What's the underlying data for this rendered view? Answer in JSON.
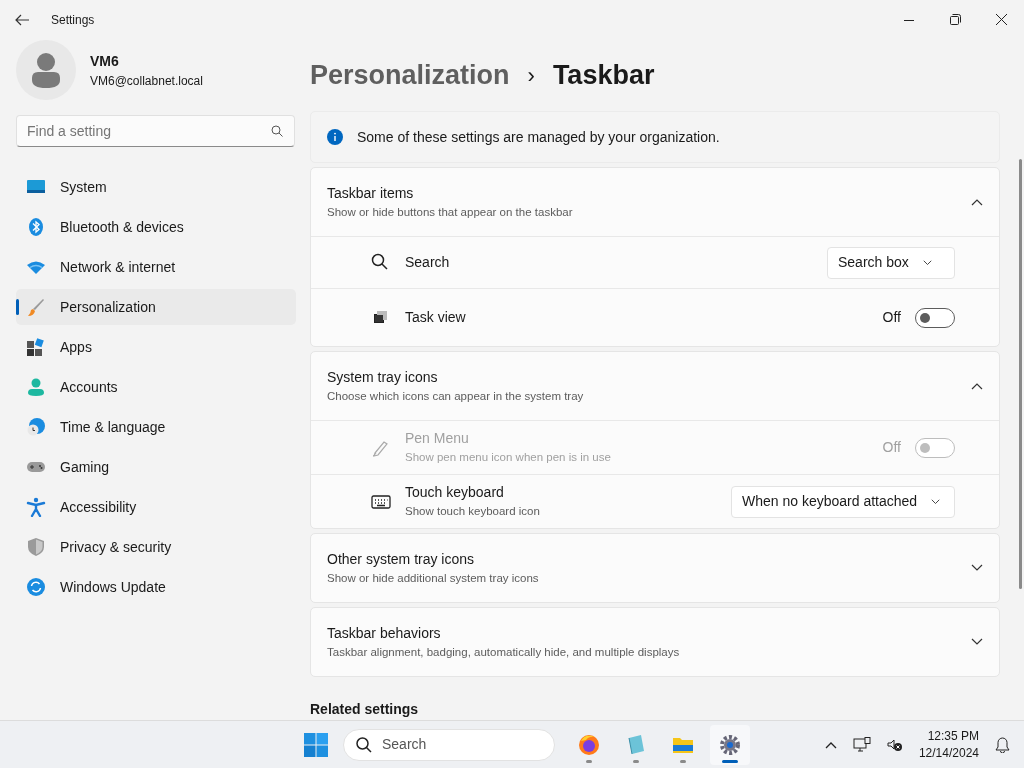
{
  "window": {
    "title": "Settings"
  },
  "user": {
    "name": "VM6",
    "email": "VM6@collabnet.local"
  },
  "search": {
    "placeholder": "Find a setting"
  },
  "nav": [
    {
      "label": "System",
      "selected": false
    },
    {
      "label": "Bluetooth & devices",
      "selected": false
    },
    {
      "label": "Network & internet",
      "selected": false
    },
    {
      "label": "Personalization",
      "selected": true
    },
    {
      "label": "Apps",
      "selected": false
    },
    {
      "label": "Accounts",
      "selected": false
    },
    {
      "label": "Time & language",
      "selected": false
    },
    {
      "label": "Gaming",
      "selected": false
    },
    {
      "label": "Accessibility",
      "selected": false
    },
    {
      "label": "Privacy & security",
      "selected": false
    },
    {
      "label": "Windows Update",
      "selected": false
    }
  ],
  "breadcrumb": {
    "parent": "Personalization",
    "separator": "›",
    "current": "Taskbar"
  },
  "notice": "Some of these settings are managed by your organization.",
  "sections": [
    {
      "title": "Taskbar items",
      "subtitle": "Show or hide buttons that appear on the taskbar",
      "expanded": true,
      "rows": [
        {
          "kind": "dropdown",
          "label": "Search",
          "value": "Search box",
          "disabled": false
        },
        {
          "kind": "toggle",
          "label": "Task view",
          "state_text": "Off",
          "on": false,
          "disabled": false
        }
      ]
    },
    {
      "title": "System tray icons",
      "subtitle": "Choose which icons can appear in the system tray",
      "expanded": true,
      "rows": [
        {
          "kind": "toggle",
          "label": "Pen Menu",
          "description": "Show pen menu icon when pen is in use",
          "state_text": "Off",
          "on": false,
          "disabled": true
        },
        {
          "kind": "dropdown",
          "label": "Touch keyboard",
          "description": "Show touch keyboard icon",
          "value": "When no keyboard attached",
          "disabled": false
        }
      ]
    },
    {
      "title": "Other system tray icons",
      "subtitle": "Show or hide additional system tray icons",
      "expanded": false
    },
    {
      "title": "Taskbar behaviors",
      "subtitle": "Taskbar alignment, badging, automatically hide, and multiple displays",
      "expanded": false
    }
  ],
  "related_heading": "Related settings",
  "taskbar": {
    "search_placeholder": "Search",
    "apps": [
      {
        "selected": false
      },
      {
        "selected": false
      },
      {
        "selected": false
      },
      {
        "selected": true
      }
    ],
    "time": "12:35 PM",
    "date": "12/14/2024"
  }
}
